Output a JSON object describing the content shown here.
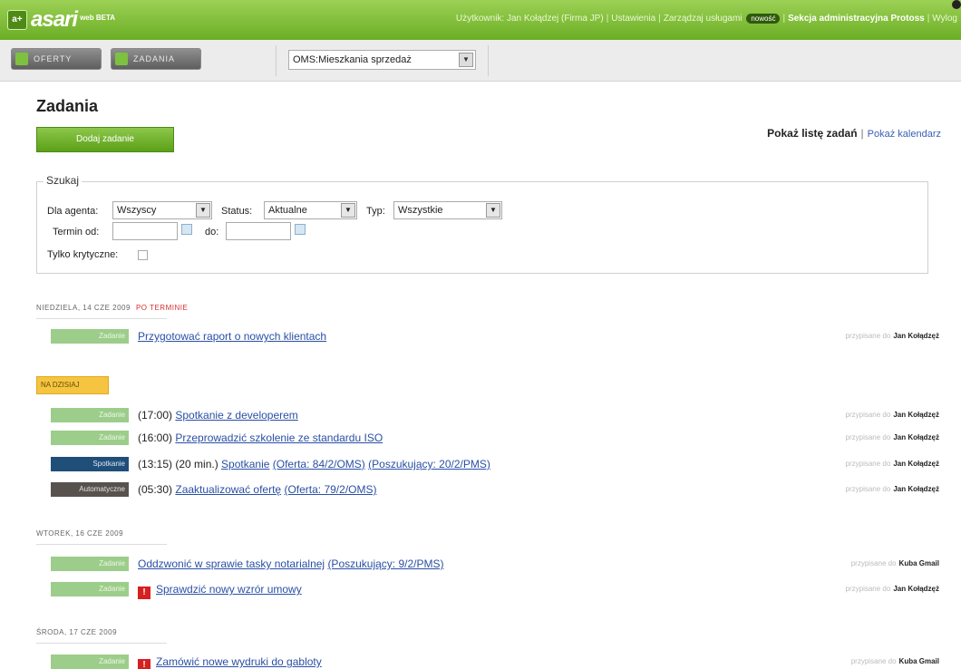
{
  "header": {
    "logo_text": "asari",
    "logo_sup": "web BETA",
    "logo_mark": "a+",
    "nav": {
      "user": "Użytkownik: Jan Kołądzej (Firma JP)",
      "settings": "Ustawienia",
      "manage": "Zarządzaj usługami",
      "new_badge": "nowość",
      "admin": "Sekcja administracyjna Protoss",
      "logout": "Wylog"
    }
  },
  "toolbar": {
    "oferty_label": "OFERTY",
    "zadania_label": "ZADANIA",
    "context_select": "OMS:Mieszkania sprzedaż"
  },
  "main": {
    "title": "Zadania",
    "add_button": "Dodaj zadanie",
    "view_list": "Pokaż listę zadań",
    "view_sep": "|",
    "view_calendar": "Pokaż kalendarz"
  },
  "search": {
    "legend": "Szukaj",
    "agent_label": "Dla agenta:",
    "agent_value": "Wszyscy",
    "status_label": "Status:",
    "status_value": "Aktualne",
    "type_label": "Typ:",
    "type_value": "Wszystkie",
    "date_from_label": "Termin od:",
    "date_to_label": "do:",
    "critical_label": "Tylko krytyczne:"
  },
  "assigned_prefix": "przypisane do",
  "groups": [
    {
      "heading": "NIEDZIELA, 14 CZE 2009",
      "late": "PO TERMINIE",
      "tasks": [
        {
          "tag": "Zadanie",
          "time": "",
          "title": "Przygotować raport o nowych klientach",
          "extra": [],
          "assignee": "Jan Kołądzęż"
        }
      ]
    },
    {
      "heading": "NA DZISIAJ",
      "tasks": [
        {
          "tag": "Zadanie",
          "time": "(17:00)",
          "title": "Spotkanie z developerem",
          "extra": [],
          "assignee": "Jan Kołądzęż"
        },
        {
          "tag": "Zadanie",
          "time": "(16:00)",
          "title": "Przeprowadzić szkolenie ze standardu ISO",
          "extra": [],
          "assignee": "Jan Kołądzęż"
        },
        {
          "tag": "Spotkanie",
          "time": "(13:15) (20 min.)",
          "title": "Spotkanie",
          "extra": [
            "(Oferta: 84/2/OMS)",
            "(Poszukujący: 20/2/PMS)"
          ],
          "assignee": "Jan Kołądzęż"
        },
        {
          "tag": "Automatyczne",
          "time": "(05:30)",
          "title": "Zaaktualizować ofertę",
          "extra": [
            "(Oferta: 79/2/OMS)"
          ],
          "assignee": "Jan Kołądzęż"
        }
      ]
    },
    {
      "heading": "WTOREK, 16 CZE 2009",
      "tasks": [
        {
          "tag": "Zadanie",
          "time": "",
          "title": "Oddzwonić w sprawie tasky notarialnej",
          "extra": [
            "(Poszukujący: 9/2/PMS)"
          ],
          "assignee": "Kuba Gmail"
        },
        {
          "tag": "Zadanie",
          "critical": "!",
          "time": "",
          "title": "Sprawdzić nowy wzrór umowy",
          "extra": [],
          "assignee": "Jan Kołądzęż"
        }
      ]
    },
    {
      "heading": "ŚRODA, 17 CZE 2009",
      "tasks": [
        {
          "tag": "Zadanie",
          "critical": "!",
          "time": "",
          "title": "Zamówić nowe wydruki do gabloty",
          "extra": [],
          "assignee": "Kuba Gmail"
        }
      ]
    }
  ]
}
